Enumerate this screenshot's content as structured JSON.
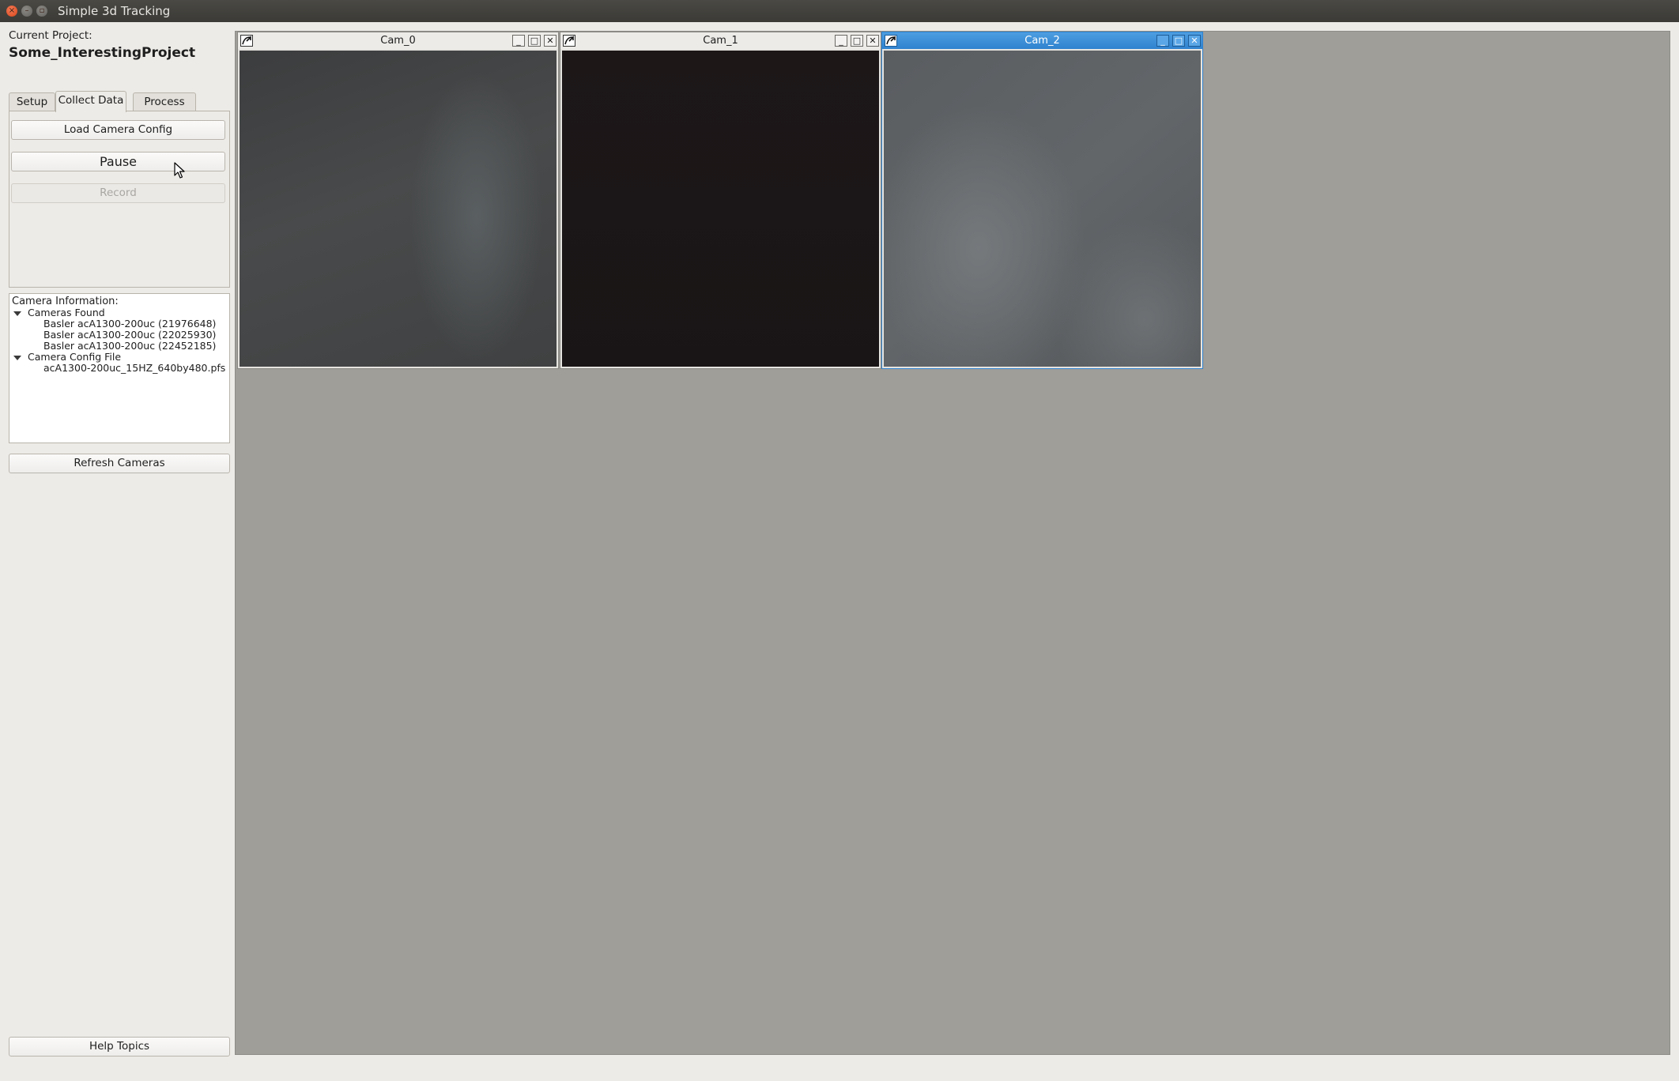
{
  "window": {
    "title": "Simple 3d Tracking",
    "close_glyph": "×",
    "min_glyph": "–",
    "max_glyph": "▫"
  },
  "sidebar": {
    "project_caption": "Current Project:",
    "project_name": "Some_InterestingProject",
    "tabs": [
      {
        "label": "Setup",
        "active": false
      },
      {
        "label": "Collect Data",
        "active": true
      },
      {
        "label": "Process",
        "active": false
      }
    ],
    "collect": {
      "load_label": "Load Camera Config",
      "pause_label": "Pause",
      "record_label": "Record",
      "record_enabled": false
    },
    "camera_info": {
      "title": "Camera Information:",
      "groups": [
        {
          "label": "Cameras Found",
          "items": [
            "Basler acA1300-200uc (21976648)",
            "Basler acA1300-200uc (22025930)",
            "Basler acA1300-200uc (22452185)"
          ]
        },
        {
          "label": "Camera Config File",
          "items": [
            "acA1300-200uc_15HZ_640by480.pfs"
          ]
        }
      ]
    },
    "refresh_label": "Refresh Cameras",
    "help_label": "Help Topics"
  },
  "mdi": {
    "subwindows": [
      {
        "title": "Cam_0",
        "active": false
      },
      {
        "title": "Cam_1",
        "active": false
      },
      {
        "title": "Cam_2",
        "active": true
      }
    ],
    "min_glyph": "_",
    "max_glyph": "□",
    "close_glyph": "✕"
  },
  "colors": {
    "active_title": "#2f82cf",
    "mdi_background": "#9f9e99",
    "close_button": "#d9461c"
  },
  "icons": {
    "window_controls": [
      "close-icon",
      "minimize-icon",
      "maximize-icon"
    ],
    "subwindow_controls": [
      "app-icon",
      "minimize-icon",
      "maximize-icon",
      "close-icon"
    ],
    "tree": "expand-triangle-icon",
    "pointer": "mouse-cursor-icon"
  }
}
